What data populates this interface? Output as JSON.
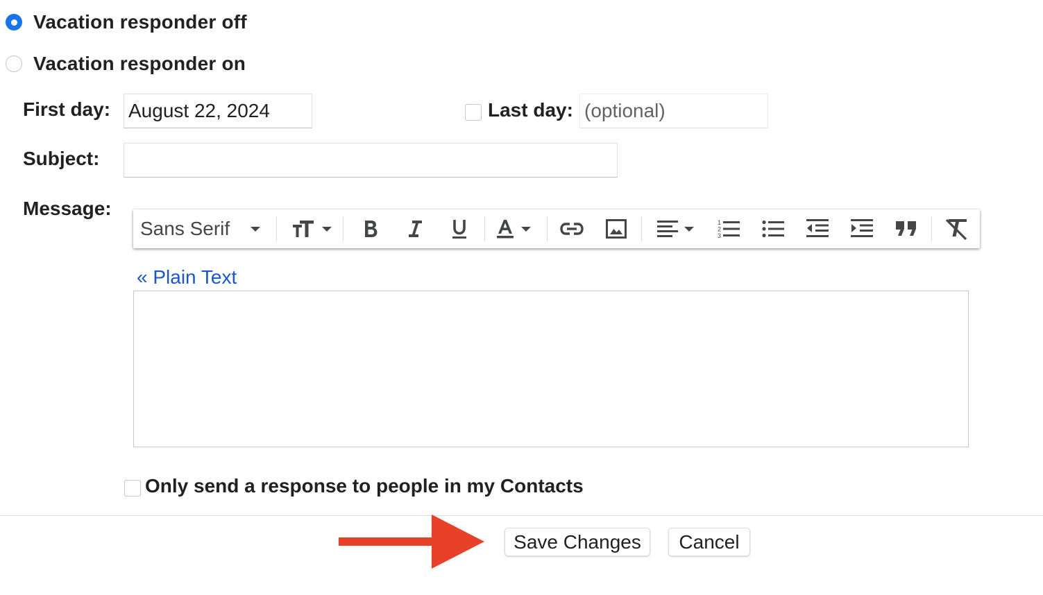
{
  "vacation": {
    "off_label": "Vacation responder off",
    "on_label": "Vacation responder on",
    "selected": "off"
  },
  "first_day": {
    "label": "First day:",
    "value": "August 22, 2024"
  },
  "last_day": {
    "label": "Last day:",
    "placeholder": "(optional)",
    "checked": false
  },
  "subject": {
    "label": "Subject:",
    "value": ""
  },
  "message": {
    "label": "Message:",
    "plain_text_link": "« Plain Text",
    "value": ""
  },
  "toolbar": {
    "font_family": "Sans Serif",
    "buttons": [
      "font-size",
      "bold",
      "italic",
      "underline",
      "text-color",
      "link",
      "image",
      "align",
      "numbered-list",
      "bulleted-list",
      "indent-less",
      "indent-more",
      "quote",
      "remove-formatting"
    ]
  },
  "contacts_only": {
    "label": "Only send a response to people in my Contacts",
    "checked": false
  },
  "actions": {
    "save_label": "Save Changes",
    "cancel_label": "Cancel"
  },
  "colors": {
    "accent": "#1a73e8",
    "link": "#1a57c8",
    "arrow": "#e8412a"
  }
}
